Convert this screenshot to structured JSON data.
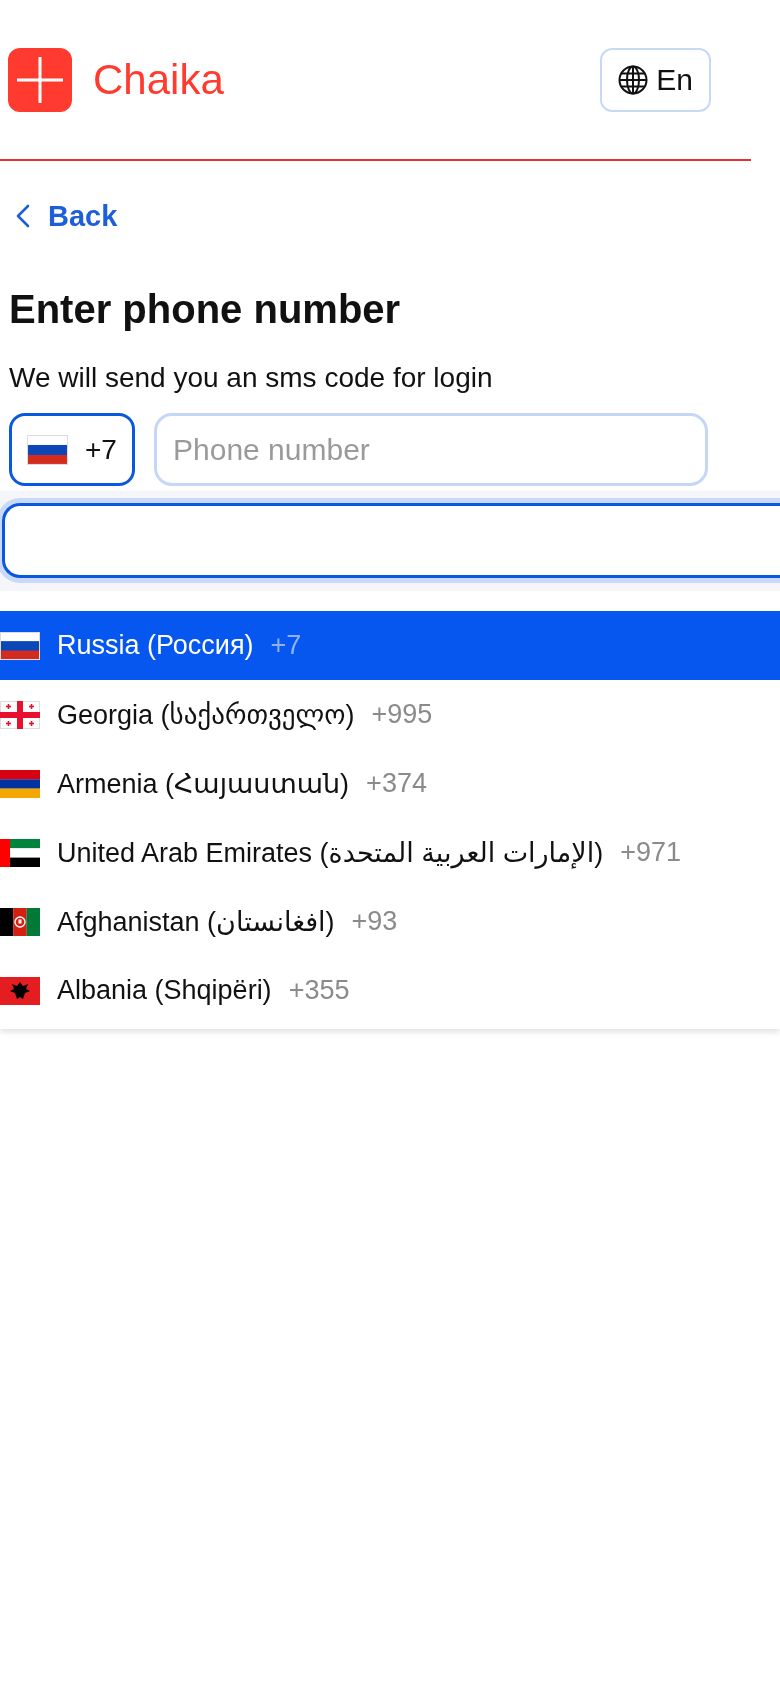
{
  "header": {
    "brand": "Chaika",
    "language": "En"
  },
  "back": "Back",
  "title": "Enter phone number",
  "subtitle": "We will send you an sms code for login",
  "phone": {
    "country_button": {
      "kind": "russia",
      "code": "+7",
      "active": true
    },
    "number": {
      "placeholder": "Phone number",
      "focused": false
    }
  },
  "country_picker": {
    "open": true,
    "search": {
      "focused": true
    },
    "countries": [
      {
        "kind": "russia",
        "name": "Russia (Россия)",
        "code": "+7",
        "selected": true
      },
      {
        "kind": "georgia",
        "name": "Georgia (საქართველო)",
        "code": "+995",
        "selected": false
      },
      {
        "kind": "armenia",
        "name": "Armenia (Հայաստան)",
        "code": "+374",
        "selected": false
      },
      {
        "kind": "uae",
        "name": "United Arab Emirates (الإمارات العربية المتحدة)",
        "code": "+971",
        "selected": false
      },
      {
        "kind": "afghanistan",
        "name": "Afghanistan (افغانستان)",
        "code": "+93",
        "selected": false
      },
      {
        "kind": "albania",
        "name": "Albania (Shqipëri)",
        "code": "+355",
        "selected": false
      }
    ]
  }
}
